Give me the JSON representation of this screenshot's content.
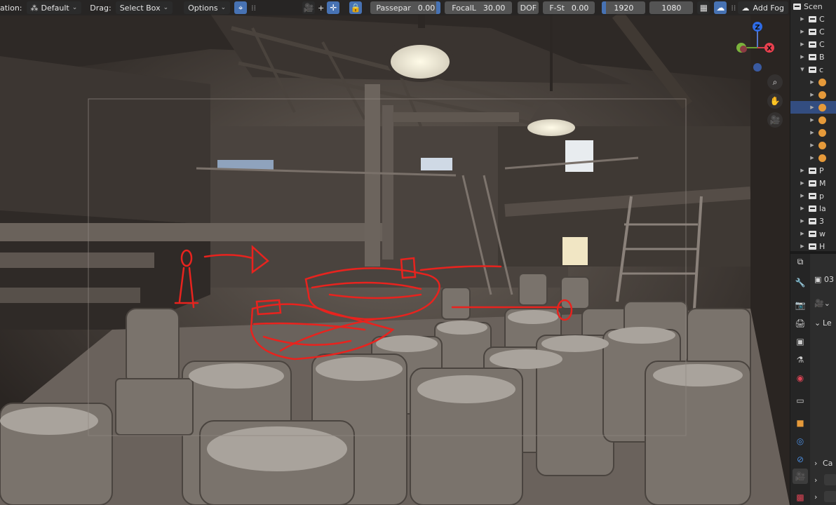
{
  "header": {
    "orientation_label": "ation:",
    "orientation_value": "Default",
    "drag_label": "Drag:",
    "drag_value": "Select Box",
    "options_label": "Options",
    "passepar_label": "Passepar",
    "passepar_value": "0.00",
    "focal_label": "FocalL",
    "focal_value": "30.00",
    "dof_label": "DOF",
    "fstop_label": "F-St",
    "fstop_value": "0.00",
    "res_x": "1920",
    "res_y": "1080",
    "add_fog_label": "Add Fog"
  },
  "gizmo": {
    "z": "Z",
    "x": "X"
  },
  "outliner": {
    "items": [
      {
        "label": "Scen",
        "kind": "scene"
      },
      {
        "label": "C",
        "kind": "collection"
      },
      {
        "label": "C",
        "kind": "collection"
      },
      {
        "label": "C",
        "kind": "collection"
      },
      {
        "label": "B",
        "kind": "collection"
      },
      {
        "label": "c",
        "kind": "collection"
      },
      {
        "label": "",
        "kind": "object"
      },
      {
        "label": "",
        "kind": "object"
      },
      {
        "label": "",
        "kind": "object"
      },
      {
        "label": "",
        "kind": "object"
      },
      {
        "label": "",
        "kind": "object"
      },
      {
        "label": "",
        "kind": "object"
      },
      {
        "label": "",
        "kind": "object"
      },
      {
        "label": "P",
        "kind": "collection"
      },
      {
        "label": "M",
        "kind": "collection"
      },
      {
        "label": "p",
        "kind": "collection"
      },
      {
        "label": "la",
        "kind": "collection"
      },
      {
        "label": "3",
        "kind": "collection"
      },
      {
        "label": "w",
        "kind": "collection"
      },
      {
        "label": "H",
        "kind": "collection"
      }
    ]
  },
  "properties": {
    "object_name": "03",
    "panel_lens": "Le",
    "panel_camera": "Ca"
  },
  "colors": {
    "accent": "#4772b3",
    "sketch": "#e8231e",
    "object": "#e69a3a"
  }
}
